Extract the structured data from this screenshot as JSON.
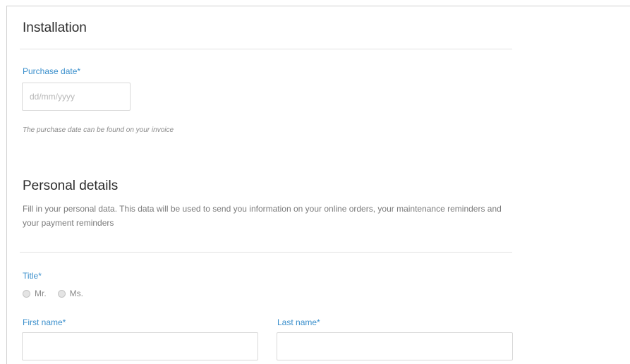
{
  "installation": {
    "title": "Installation",
    "purchase_date_label": "Purchase date*",
    "purchase_date_placeholder": "dd/mm/yyyy",
    "purchase_date_value": "",
    "purchase_date_hint": "The purchase date can be found on your invoice"
  },
  "personal": {
    "title": "Personal details",
    "description": "Fill in your personal data. This data will be used to send you information on your online orders, your maintenance reminders and your payment reminders",
    "title_field_label": "Title*",
    "title_options": [
      {
        "label": "Mr.",
        "selected": false
      },
      {
        "label": "Ms.",
        "selected": false
      }
    ],
    "first_name_label": "First name*",
    "first_name_value": "",
    "last_name_label": "Last name*",
    "last_name_value": ""
  },
  "colors": {
    "label_accent": "#3a8fcc",
    "heading": "#2b2b2b",
    "muted_text": "#7a7a7a",
    "input_border": "#d9d9d9"
  }
}
